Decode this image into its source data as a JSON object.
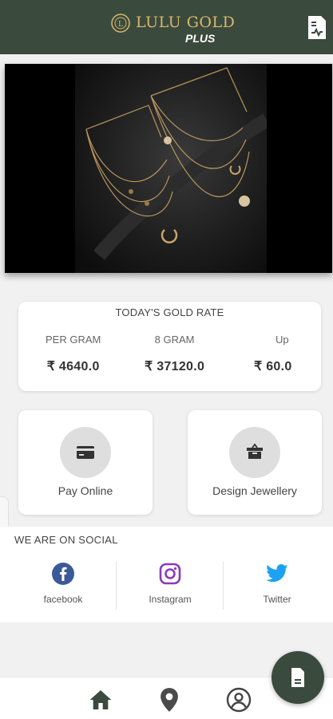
{
  "header": {
    "brand_name": "LULU GOLD",
    "brand_suffix": "PLUS"
  },
  "gold_rate": {
    "title": "TODAY'S GOLD RATE",
    "columns": [
      {
        "label": "PER GRAM",
        "value": "₹ 4640.0"
      },
      {
        "label": "8 GRAM",
        "value": "₹ 37120.0"
      },
      {
        "label": "Up",
        "value": "₹ 60.0"
      }
    ]
  },
  "actions": [
    {
      "label": "Pay Online",
      "icon": "card-icon"
    },
    {
      "label": "Design Jewellery",
      "icon": "box-icon"
    }
  ],
  "social": {
    "title": "WE ARE ON SOCIAL",
    "items": [
      {
        "label": "facebook",
        "icon": "facebook-icon",
        "color": "#3b5998"
      },
      {
        "label": "Instagram",
        "icon": "instagram-icon",
        "color": "#8a3ab9"
      },
      {
        "label": "Twitter",
        "icon": "twitter-icon",
        "color": "#1da1f2"
      }
    ]
  },
  "bottom_nav": [
    "home-icon",
    "location-icon",
    "profile-icon"
  ],
  "colors": {
    "primary": "#3a4a3d",
    "gold": "#d9b86b",
    "background": "#f1f1f1"
  }
}
